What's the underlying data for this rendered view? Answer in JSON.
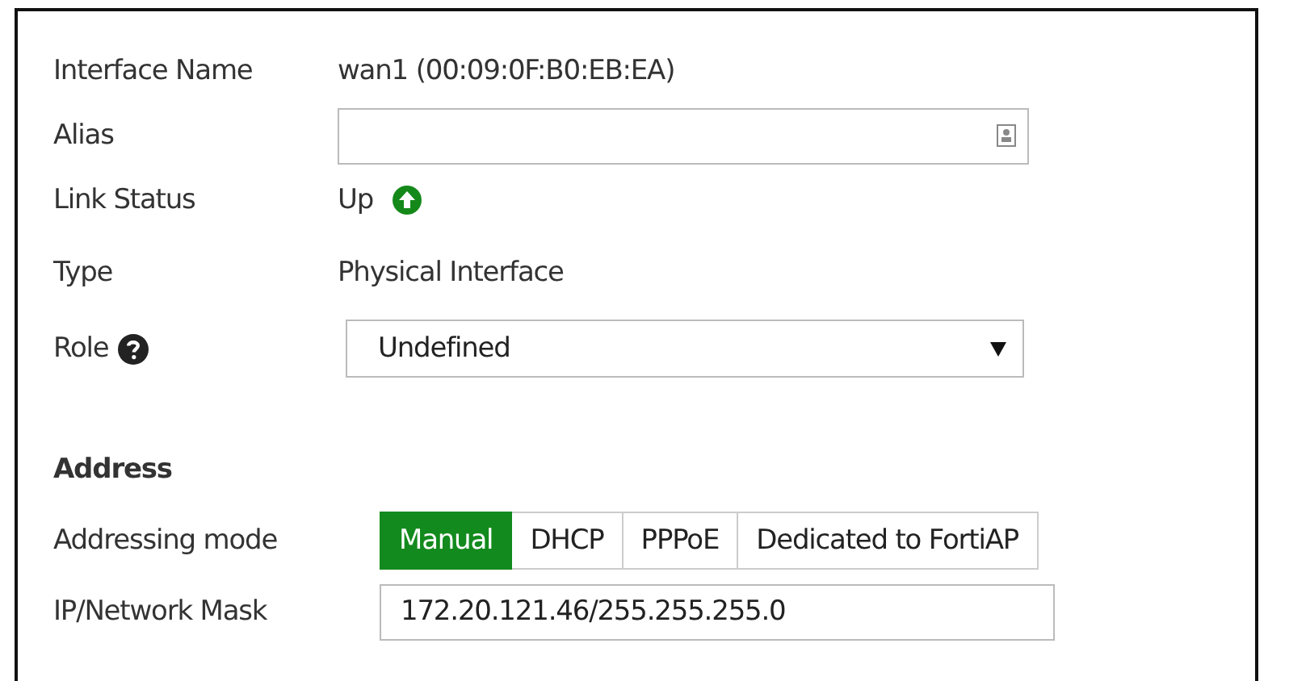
{
  "interface_name": {
    "label": "Interface Name",
    "value": "wan1 (00:09:0F:B0:EB:EA)"
  },
  "alias": {
    "label": "Alias"
  },
  "link_status": {
    "label": "Link Status",
    "value": "Up",
    "up": true
  },
  "type": {
    "label": "Type",
    "value": "Physical Interface"
  },
  "role": {
    "label": "Role",
    "value": "Undefined"
  },
  "address": {
    "heading": "Address",
    "addressing_mode": {
      "label": "Addressing mode",
      "options": [
        {
          "label": "Manual",
          "selected": true
        },
        {
          "label": "DHCP",
          "selected": false
        },
        {
          "label": "PPPoE",
          "selected": false
        },
        {
          "label": "Dedicated to FortiAP",
          "selected": false
        }
      ]
    },
    "ip_mask": {
      "label": "IP/Network Mask",
      "value": "172.20.121.46/255.255.255.0"
    }
  }
}
